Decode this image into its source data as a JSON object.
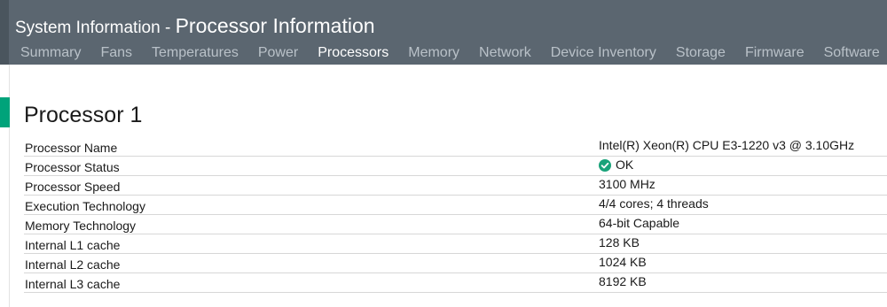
{
  "header": {
    "app_title": "System Information",
    "separator": " - ",
    "page_title": "Processor Information"
  },
  "tabs": [
    {
      "label": "Summary"
    },
    {
      "label": "Fans"
    },
    {
      "label": "Temperatures"
    },
    {
      "label": "Power"
    },
    {
      "label": "Processors",
      "active": true
    },
    {
      "label": "Memory"
    },
    {
      "label": "Network"
    },
    {
      "label": "Device Inventory"
    },
    {
      "label": "Storage"
    },
    {
      "label": "Firmware"
    },
    {
      "label": "Software"
    }
  ],
  "section": {
    "title": "Processor 1",
    "rows": [
      {
        "label": "Processor Name",
        "value": "Intel(R) Xeon(R) CPU E3-1220 v3 @ 3.10GHz"
      },
      {
        "label": "Processor Status",
        "value": "OK",
        "icon": "ok-check-icon"
      },
      {
        "label": "Processor Speed",
        "value": "3100 MHz"
      },
      {
        "label": "Execution Technology",
        "value": "4/4 cores; 4 threads"
      },
      {
        "label": "Memory Technology",
        "value": "64-bit Capable"
      },
      {
        "label": "Internal L1 cache",
        "value": "128 KB"
      },
      {
        "label": "Internal L2 cache",
        "value": "1024 KB"
      },
      {
        "label": "Internal L3 cache",
        "value": "8192 KB"
      }
    ]
  },
  "colors": {
    "header_bg": "#5b6670",
    "tab_inactive": "#b9c1c8",
    "tab_active": "#ffffff",
    "accent": "#00a37a",
    "status_ok": "#1aa37a"
  }
}
